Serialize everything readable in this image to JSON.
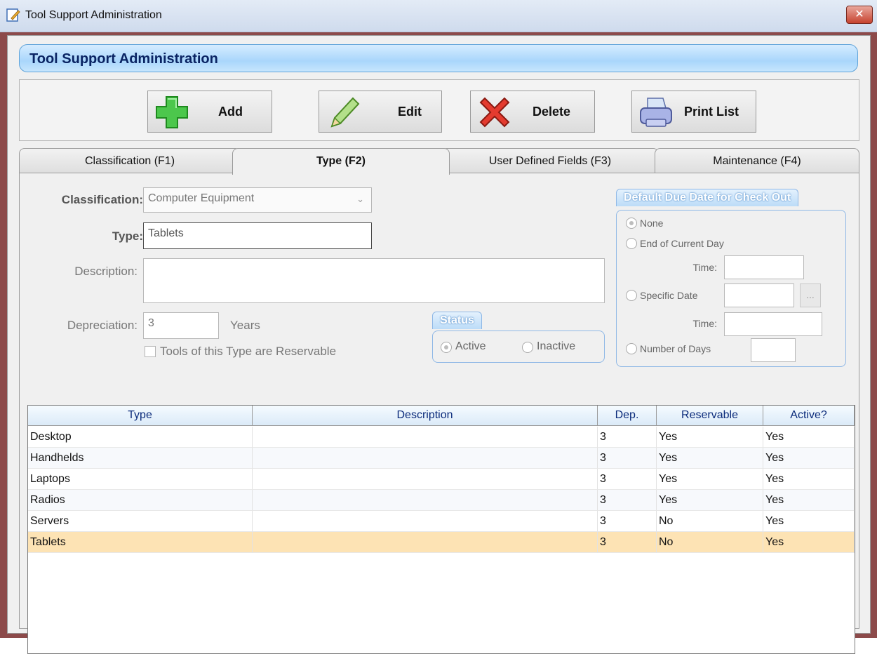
{
  "window": {
    "title": "Tool Support Administration",
    "close_glyph": "✕"
  },
  "header": {
    "title": "Tool Support Administration"
  },
  "toolbar": {
    "add_label": "Add",
    "edit_label": "Edit",
    "delete_label": "Delete",
    "print_label": "Print List"
  },
  "tabs": [
    {
      "label": "Classification (F1)"
    },
    {
      "label": "Type (F2)"
    },
    {
      "label": "User Defined Fields (F3)"
    },
    {
      "label": "Maintenance (F4)"
    }
  ],
  "form": {
    "classification_label": "Classification:",
    "classification_value": "Computer Equipment",
    "type_label": "Type:",
    "type_value": "Tablets",
    "description_label": "Description:",
    "description_value": "",
    "depreciation_label": "Depreciation:",
    "depreciation_value": "3",
    "years_label": "Years",
    "reservable_label": "Tools of this Type are Reservable"
  },
  "status": {
    "title": "Status",
    "active_label": "Active",
    "inactive_label": "Inactive",
    "selected": "Active"
  },
  "due_date": {
    "title": "Default Due Date for Check Out",
    "none_label": "None",
    "end_of_day_label": "End of Current Day",
    "time_label": "Time:",
    "specific_date_label": "Specific Date",
    "time2_label": "Time:",
    "number_of_days_label": "Number of Days",
    "ellipsis": "...",
    "selected": "None"
  },
  "grid": {
    "columns": [
      "Type",
      "Description",
      "Dep.",
      "Reservable",
      "Active?"
    ],
    "rows": [
      {
        "type": "Desktop",
        "description": "",
        "dep": "3",
        "reservable": "Yes",
        "active": "Yes"
      },
      {
        "type": "Handhelds",
        "description": "",
        "dep": "3",
        "reservable": "Yes",
        "active": "Yes"
      },
      {
        "type": "Laptops",
        "description": "",
        "dep": "3",
        "reservable": "Yes",
        "active": "Yes"
      },
      {
        "type": "Radios",
        "description": "",
        "dep": "3",
        "reservable": "Yes",
        "active": "Yes"
      },
      {
        "type": "Servers",
        "description": "",
        "dep": "3",
        "reservable": "No",
        "active": "Yes"
      },
      {
        "type": "Tablets",
        "description": "",
        "dep": "3",
        "reservable": "No",
        "active": "Yes"
      }
    ],
    "selected_row": "Tablets"
  },
  "colors": {
    "banner_text": "#0a2463",
    "selected_row": "#fde3b4",
    "frame": "#8c4a4a"
  }
}
